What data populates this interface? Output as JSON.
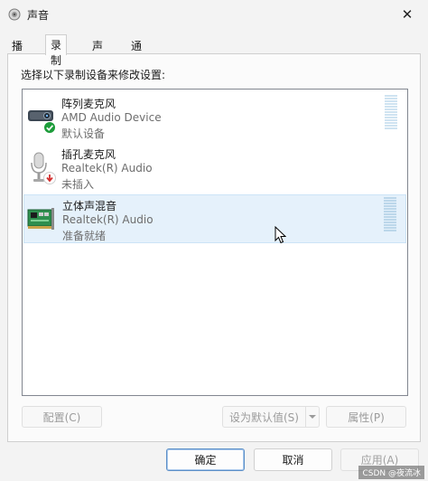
{
  "window": {
    "title": "声音",
    "close_symbol": "✕"
  },
  "tabs": [
    {
      "label": "播放",
      "active": false
    },
    {
      "label": "录制",
      "active": true
    },
    {
      "label": "声音",
      "active": false
    },
    {
      "label": "通信",
      "active": false
    }
  ],
  "panel": {
    "instruction": "选择以下录制设备来修改设置:",
    "devices": [
      {
        "name": "阵列麦克风",
        "driver": "AMD Audio Device",
        "status": "默认设备",
        "icon": "webcam-microphone-icon",
        "badge": "green-check-icon",
        "selected": false
      },
      {
        "name": "插孔麦克风",
        "driver": "Realtek(R) Audio",
        "status": "未插入",
        "icon": "microphone-icon",
        "badge": "red-down-arrow-icon",
        "selected": false
      },
      {
        "name": "立体声混音",
        "driver": "Realtek(R) Audio",
        "status": "准备就绪",
        "icon": "sound-card-icon",
        "badge": "",
        "selected": true
      }
    ],
    "buttons": {
      "configure": "配置(C)",
      "set_default": "设为默认值(S)",
      "properties": "属性(P)"
    }
  },
  "footer": {
    "ok": "确定",
    "cancel": "取消",
    "apply": "应用(A)"
  },
  "watermark": "CSDN @夜流冰",
  "colors": {
    "selection_bg": "#e5f1fb",
    "selection_border": "#cce4f7",
    "meter": "#cfe3f1",
    "accent_border": "#5c8fc7"
  }
}
